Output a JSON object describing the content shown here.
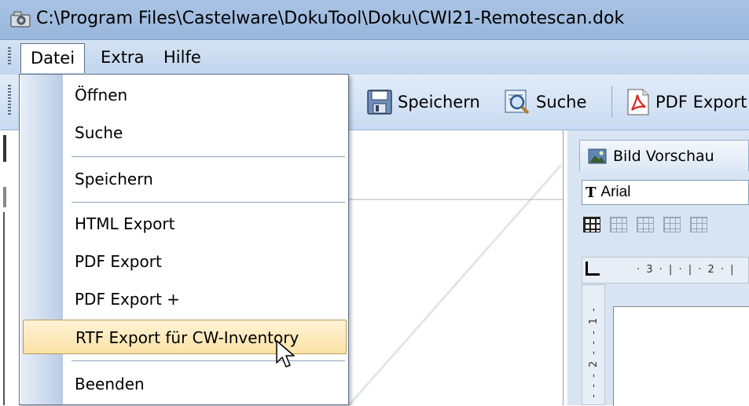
{
  "window": {
    "title": "C:\\Program Files\\Castelware\\DokuTool\\Doku\\CWI21-Remotescan.dok",
    "icon": "camera-app-icon"
  },
  "menubar": {
    "items": [
      "Datei",
      "Extra",
      "Hilfe"
    ]
  },
  "toolbar": {
    "save_label": "Speichern",
    "search_label": "Suche",
    "pdf_label": "PDF Export"
  },
  "dropdown": {
    "open_menu": "Datei",
    "items": [
      "Öffnen",
      "Suche",
      "Speichern",
      "HTML Export",
      "PDF Export",
      "PDF Export +",
      "RTF Export für CW-Inventory",
      "Beenden"
    ],
    "highlighted": "RTF Export für CW-Inventory"
  },
  "right_panel": {
    "tab_label": "Bild Vorschau",
    "font_value": "Arial",
    "ruler_h": "· 3 · | · | · 2 · |",
    "ruler_v": "- - - 2 - - - 1 -"
  },
  "colors": {
    "highlight_bg": "#fbe2a6",
    "menu_border": "#5a6d8c",
    "title_bar": "#a9c3e3"
  }
}
